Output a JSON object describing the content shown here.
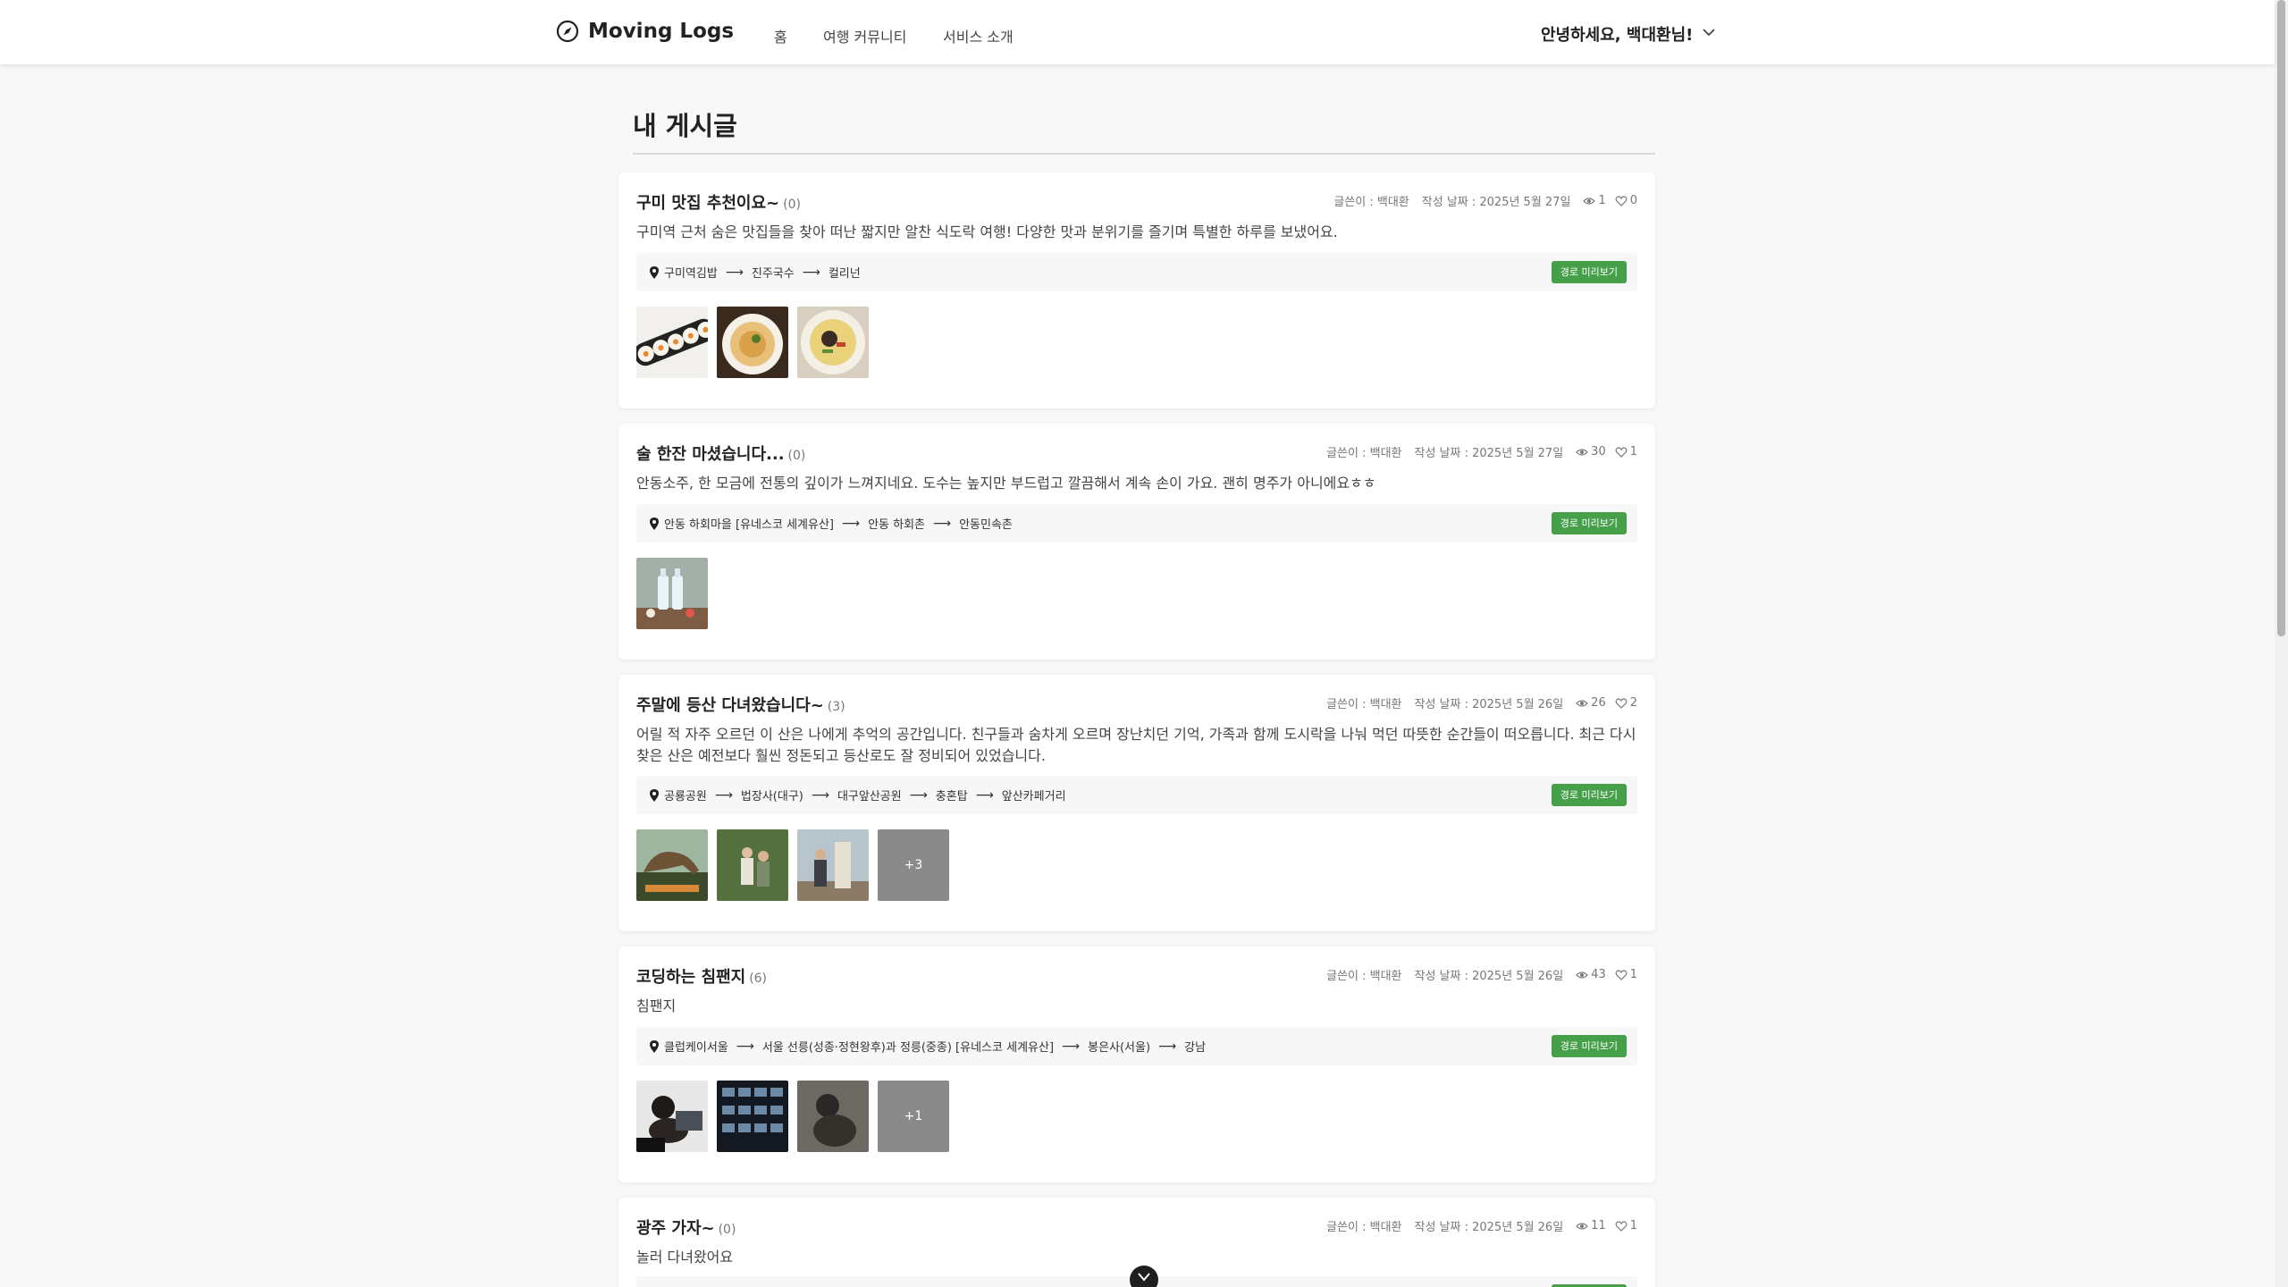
{
  "header": {
    "logo_text": "Moving Logs",
    "nav": [
      "홈",
      "여행 커뮤니티",
      "서비스 소개"
    ],
    "greeting": "안녕하세요, 백대환님!"
  },
  "page": {
    "title": "내 게시글"
  },
  "labels": {
    "author_prefix": "글쓴이 : ",
    "date_prefix": "작성 날짜 : ",
    "route_button": "경로 미리보기"
  },
  "posts": [
    {
      "title": "구미 맛집 추천이요~",
      "comment_count": "(0)",
      "author": "백대환",
      "date": "2025년 5월 27일",
      "views": "1",
      "likes": "0",
      "description": "구미역 근처 숨은 맛집들을 찾아 떠난 짧지만 알찬 식도락 여행! 다양한 맛과 분위기를 즐기며 특별한 하루를 보냈어요.",
      "route": [
        "구미역김밥",
        "진주국수",
        "컬리넌"
      ],
      "thumbnails": [
        "kimbap",
        "noodle-bowl",
        "cold-noodles"
      ],
      "more_count": null
    },
    {
      "title": "술 한잔 마셨습니다...",
      "comment_count": "(0)",
      "author": "백대환",
      "date": "2025년 5월 27일",
      "views": "30",
      "likes": "1",
      "description": "안동소주, 한 모금에 전통의 깊이가 느껴지네요. 도수는 높지만 부드럽고 깔끔해서 계속 손이 가요. 괜히 명주가 아니에요ㅎㅎ",
      "route": [
        "안동 하회마을 [유네스코 세계유산]",
        "안동 하회촌",
        "안동민속촌"
      ],
      "thumbnails": [
        "soju-bottles"
      ],
      "more_count": null
    },
    {
      "title": "주말에 등산 다녀왔습니다~",
      "comment_count": "(3)",
      "author": "백대환",
      "date": "2025년 5월 26일",
      "views": "26",
      "likes": "2",
      "description": "어릴 적 자주 오르던 이 산은 나에게 추억의 공간입니다. 친구들과 숨차게 오르며 장난치던 기억, 가족과 함께 도시락을 나눠 먹던 따뜻한 순간들이 떠오릅니다. 최근 다시 찾은 산은 예전보다 훨씬 정돈되고 등산로도 잘 정비되어 있었습니다.",
      "route": [
        "공룡공원",
        "법장사(대구)",
        "대구앞산공원",
        "충혼탑",
        "앞산카페거리"
      ],
      "thumbnails": [
        "dinosaur-statue",
        "hikers",
        "summit-stone"
      ],
      "more_count": "+3"
    },
    {
      "title": "코딩하는 침팬지",
      "comment_count": "(6)",
      "author": "백대환",
      "date": "2025년 5월 26일",
      "views": "43",
      "likes": "1",
      "description": "침팬지",
      "route": [
        "클럽케이서울",
        "서울 선릉(성종·정현왕후)과 정릉(중종) [유네스코 세계유산]",
        "봉은사(서울)",
        "강남"
      ],
      "thumbnails": [
        "chimp-laptop",
        "screen-grid",
        "chimp-sitting"
      ],
      "more_count": "+1"
    },
    {
      "title": "광주 가자~",
      "comment_count": "(0)",
      "author": "백대환",
      "date": "2025년 5월 26일",
      "views": "11",
      "likes": "1",
      "description": "놀러 다녀왔어요",
      "route": [],
      "thumbnails": [],
      "more_count": null
    }
  ]
}
